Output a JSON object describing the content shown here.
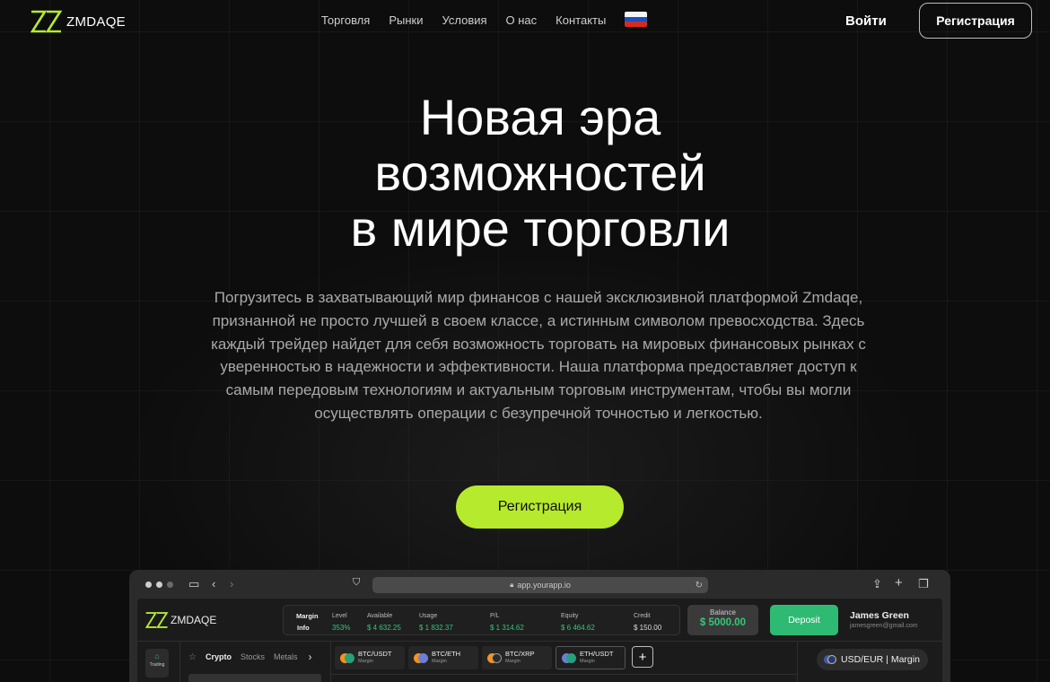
{
  "header": {
    "logo_text": "ZMDAQE",
    "nav": [
      "Торговля",
      "Рынки",
      "Условия",
      "О нас",
      "Контакты"
    ],
    "language_flag": "ru-flag-icon",
    "login_label": "Войти",
    "register_label": "Регистрация"
  },
  "hero": {
    "title_lines": [
      "Новая эра",
      "возможностей",
      "в мире торговли"
    ],
    "description": "Погрузитесь в захватывающий мир финансов с нашей эксклюзивной платформой Zmdaqe, признанной не просто лучшей в своем классе, а истинным символом превосходства. Здесь каждый трейдер найдет для себя возможность торговать на мировых финансовых рынках с уверенностью в надежности и эффективности. Наша платформа предоставляет доступ к самым передовым технологиям и актуальным торговым инструментам, чтобы вы могли осуществлять операции с безупречной точностью и легкостью.",
    "cta_label": "Регистрация"
  },
  "browser": {
    "url": "app.yourapp.io"
  },
  "app": {
    "logo_text": "ZMDAQE",
    "margin_label_1": "Margin",
    "margin_label_2": "Info",
    "stats": [
      {
        "label": "Level",
        "value": "353%"
      },
      {
        "label": "Available",
        "value": "$ 4 632.25"
      },
      {
        "label": "Usage",
        "value": "$ 1 832.37"
      },
      {
        "label": "P/L",
        "value": "$ 1 314.62"
      },
      {
        "label": "Equity",
        "value": "$ 6 464.62"
      },
      {
        "label": "Credit",
        "value": "$ 150.00"
      }
    ],
    "balance_label": "Balance",
    "balance_value": "$ 5000.00",
    "deposit_label": "Deposit",
    "user_name": "James Green",
    "user_email": "jamesgreen@gmail.com",
    "sidebar_trading": "Trading",
    "categories": [
      "Crypto",
      "Stocks",
      "Metals"
    ],
    "tabs": [
      {
        "pair": "BTC/USDT",
        "type": "Margin"
      },
      {
        "pair": "BTC/ETH",
        "type": "Margin"
      },
      {
        "pair": "BTC/XRP",
        "type": "Margin"
      },
      {
        "pair": "ETH/USDT",
        "type": "Margin"
      }
    ],
    "selected_pair": "USD/EUR",
    "selected_pair_type": "Margin",
    "accent_color": "#b6ea2c",
    "positive_color": "#33c879",
    "deposit_color": "#2fba73"
  }
}
